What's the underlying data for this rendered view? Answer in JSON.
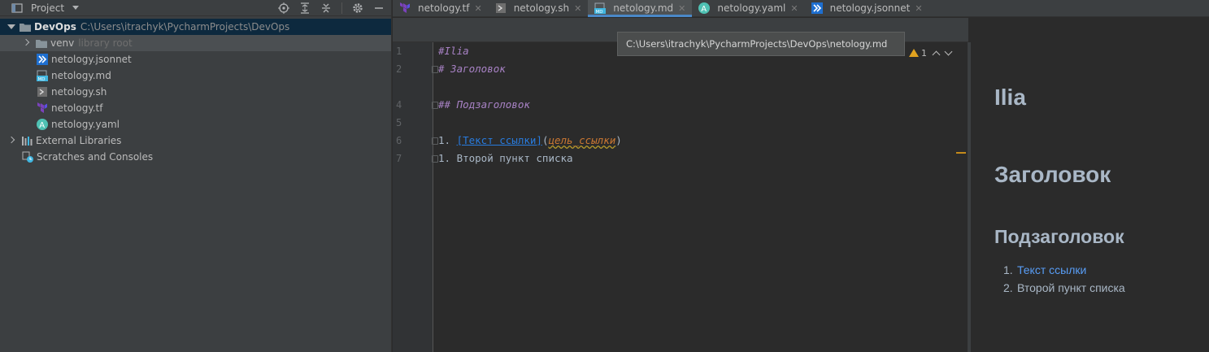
{
  "project": {
    "title": "Project",
    "root": {
      "name": "DevOps",
      "path": "C:\\Users\\itrachyk\\PycharmProjects\\DevOps"
    },
    "items": [
      {
        "name": "venv",
        "hint": "library root"
      },
      {
        "name": "netology.jsonnet"
      },
      {
        "name": "netology.md"
      },
      {
        "name": "netology.sh"
      },
      {
        "name": "netology.tf"
      },
      {
        "name": "netology.yaml"
      }
    ],
    "external": "External Libraries",
    "scratches": "Scratches and Consoles"
  },
  "tabs": [
    {
      "label": "netology.tf",
      "icon": "terraform-icon"
    },
    {
      "label": "netology.sh",
      "icon": "shell-icon"
    },
    {
      "label": "netology.md",
      "icon": "markdown-icon",
      "active": true
    },
    {
      "label": "netology.yaml",
      "icon": "yaml-icon"
    },
    {
      "label": "netology.jsonnet",
      "icon": "jsonnet-icon"
    }
  ],
  "tooltip": "C:\\Users\\itrachyk\\PycharmProjects\\DevOps\\netology.md",
  "inspections": {
    "warnings": "1"
  },
  "editor": {
    "line_numbers": [
      "1",
      "2",
      "4",
      "5",
      "6",
      "7"
    ],
    "lines": {
      "l1": "#Ilia",
      "l2": "# Заголовок",
      "l4": "## Подзаголовок",
      "l6_num": "1. ",
      "l6_link": "[Текст ссылки]",
      "l6_open": "(",
      "l6_url": "цель_ссылки",
      "l6_close": ")",
      "l7": "1. Второй пункт списка"
    }
  },
  "preview": {
    "h1a": "Ilia",
    "h1b": "Заголовок",
    "h2": "Подзаголовок",
    "list": [
      {
        "num": "1.",
        "text": "Текст ссылки"
      },
      {
        "num": "2.",
        "text": "Второй пункт списка"
      }
    ]
  },
  "colors": {
    "accent": "#4a88c7",
    "selection": "#0d293e",
    "warning": "#e0a21f"
  }
}
